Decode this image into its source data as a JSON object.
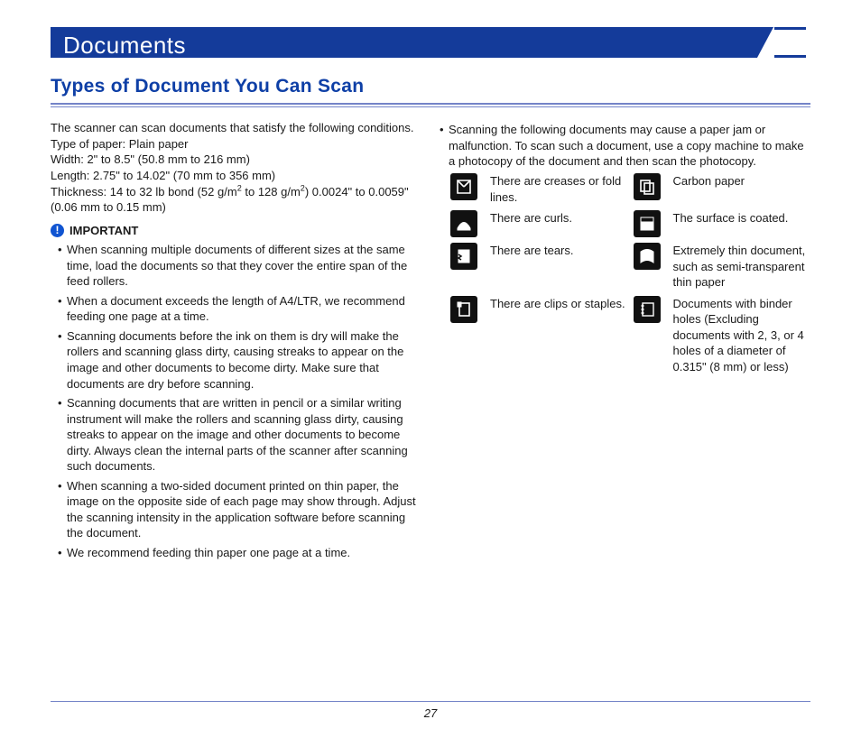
{
  "banner": {
    "title": "Documents"
  },
  "section_title": "Types of Document You Can Scan",
  "intro": {
    "line1": "The scanner can scan documents that satisfy the following conditions.",
    "line2": "Type of paper: Plain paper",
    "line3": "Width: 2\" to 8.5\" (50.8 mm to 216 mm)",
    "line4": "Length: 2.75\" to 14.02\" (70 mm to 356 mm)",
    "line5_a": "Thickness: 14 to 32 lb bond (52 g/m",
    "line5_b": " to 128 g/m",
    "line5_c": ") 0.0024\" to 0.0059\" (0.06 mm to 0.15 mm)",
    "sup": "2"
  },
  "important_label": "IMPORTANT",
  "notes": [
    "When scanning multiple documents of different sizes at the same time, load the documents so that they cover the entire span of the feed rollers.",
    "When a document exceeds the length of A4/LTR, we recommend feeding one page at a time.",
    "Scanning documents before the ink on them is dry will make the rollers and scanning glass dirty, causing streaks to appear on the image and other documents to become dirty. Make sure that documents are dry before scanning.",
    "Scanning documents that are written in pencil or a similar writing instrument will make the rollers and scanning glass dirty, causing streaks to appear on the image and other documents to become dirty. Always clean the internal parts of the scanner after scanning such documents.",
    "When scanning a two-sided document printed on thin paper, the image on the opposite side of each page may show through. Adjust the scanning intensity in the application software before scanning the document.",
    "We recommend feeding thin paper one page at a time."
  ],
  "right_intro": "Scanning the following documents may cause a paper jam or malfunction. To scan such a document, use a copy machine to make a photocopy of the document and then scan the photocopy.",
  "warn_left": [
    "There are creases or fold lines.",
    "There are curls.",
    "There are tears.",
    "There are clips or staples."
  ],
  "warn_right": [
    "Carbon paper",
    "The surface is coated.",
    "Extremely thin document, such as semi-transparent thin paper",
    "Documents with binder holes (Excluding documents with 2, 3, or 4 holes of a diameter of 0.315\" (8 mm) or less)"
  ],
  "page_number": "27"
}
